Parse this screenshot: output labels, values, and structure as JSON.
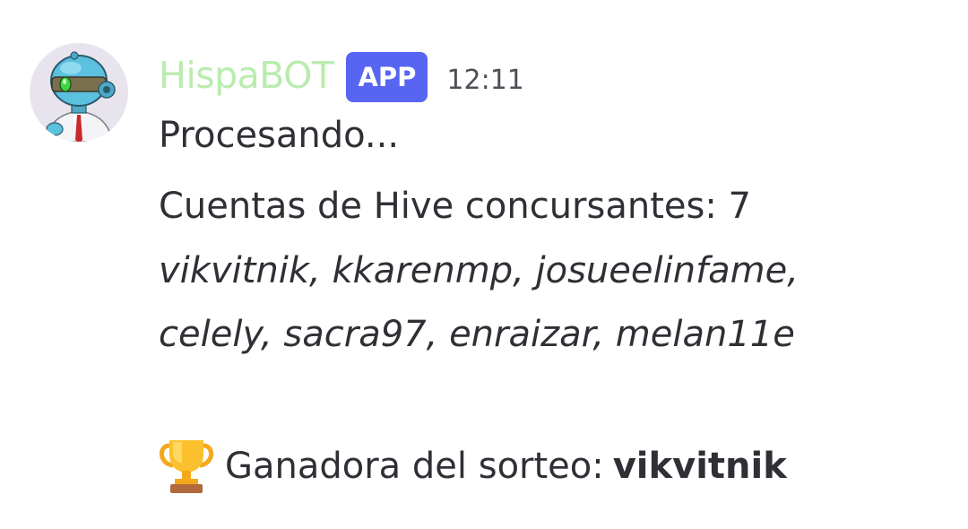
{
  "message": {
    "author": {
      "name": "HispaBOT",
      "badge": "APP",
      "avatar_icon": "robot-avatar-icon",
      "name_color": "#b9ecae",
      "badge_color": "#5865f2"
    },
    "timestamp": "12:11",
    "content": {
      "status": "Procesando...",
      "participants_line": "Cuentas de Hive concursantes: 7",
      "participants_row1": "vikvitnik, kkarenmp, josueelinfame,",
      "participants_row2": "celely, sacra97, enraizar, melan11e",
      "winner_icon": "trophy-icon",
      "winner_label": "Ganadora del sorteo:",
      "winner_name": "vikvitnik"
    }
  }
}
